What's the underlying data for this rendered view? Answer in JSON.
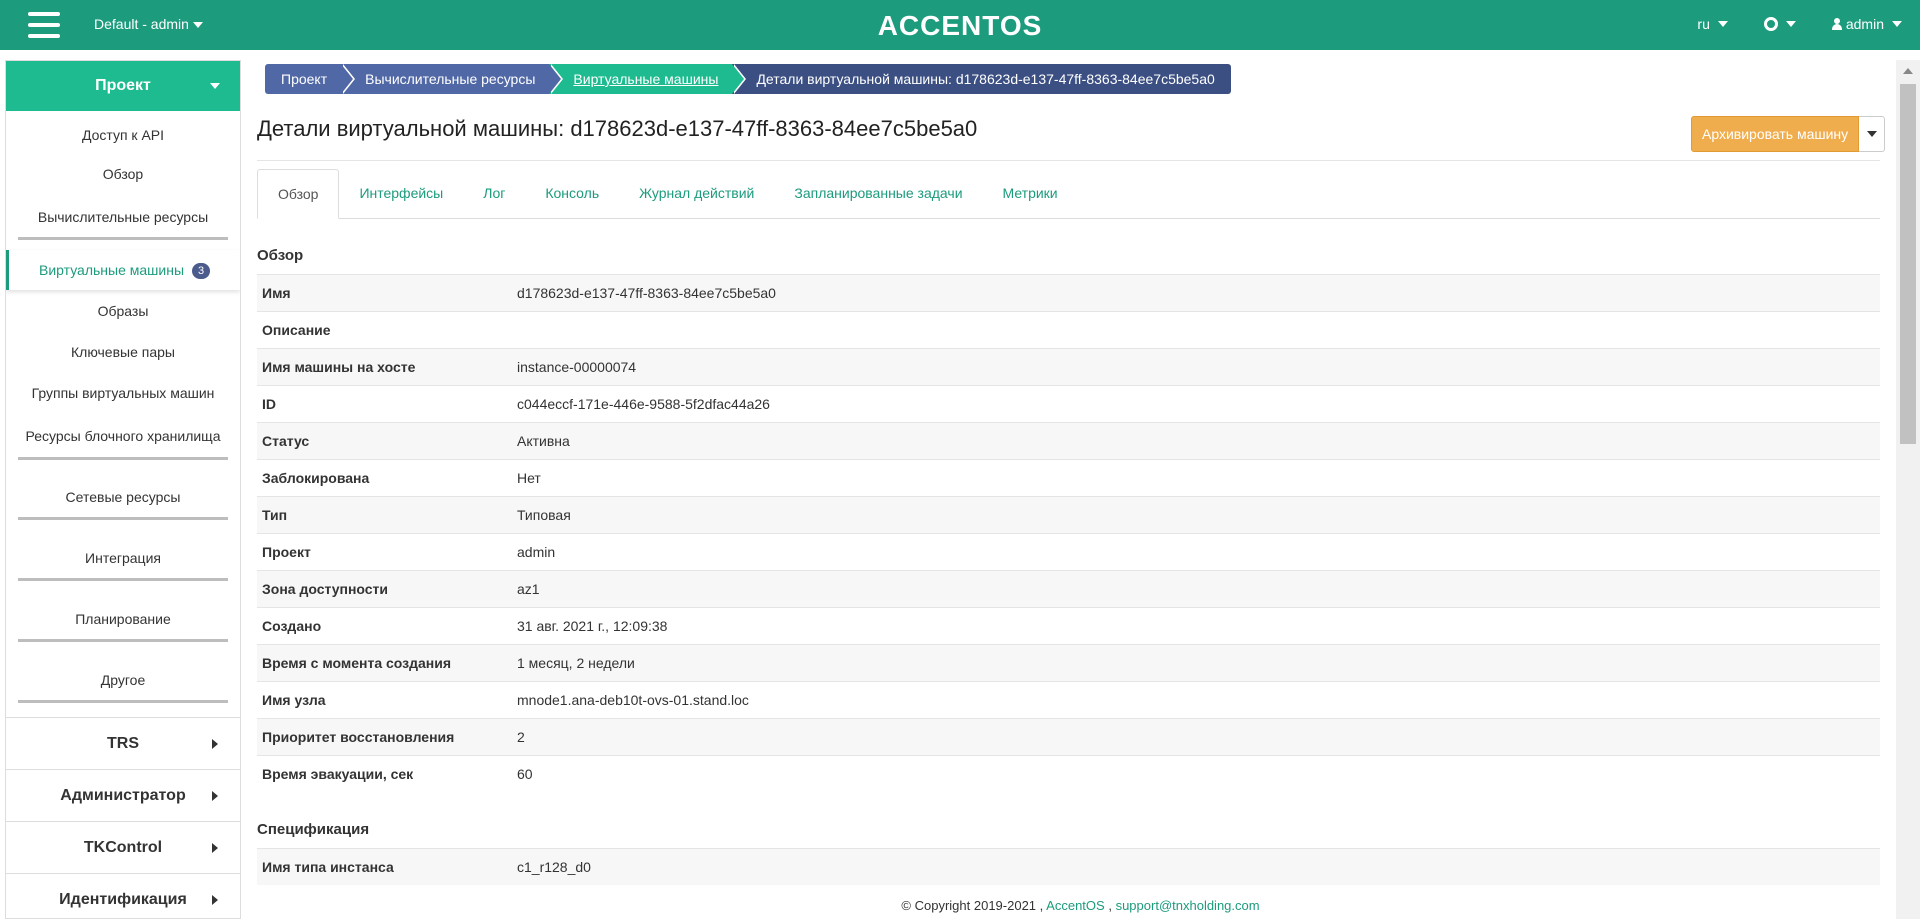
{
  "topbar": {
    "project": "Default - admin",
    "logo": "ACCENTOS",
    "lang": "ru",
    "user": "admin"
  },
  "sidebar": {
    "header": "Проект",
    "items": [
      {
        "label": "Доступ к API"
      },
      {
        "label": "Обзор"
      },
      {
        "label": "Вычислительные ресурсы"
      },
      {
        "label": "Виртуальные машины",
        "badge": "3"
      },
      {
        "label": "Образы"
      },
      {
        "label": "Ключевые пары"
      },
      {
        "label": "Группы виртуальных машин"
      },
      {
        "label": "Ресурсы блочного хранилища"
      },
      {
        "label": "Сетевые ресурсы"
      },
      {
        "label": "Интеграция"
      },
      {
        "label": "Планирование"
      },
      {
        "label": "Другое"
      }
    ],
    "sections": [
      "TRS",
      "Администратор",
      "TKControl",
      "Идентификация"
    ]
  },
  "breadcrumb": [
    "Проект",
    "Вычислительные ресурсы",
    "Виртуальные машины",
    "Детали виртуальной машины: d178623d-e137-47ff-8363-84ee7c5be5a0"
  ],
  "page": {
    "title": "Детали виртуальной машины: d178623d-e137-47ff-8363-84ee7c5be5a0",
    "archive_label": "Архивировать машину"
  },
  "tabs": [
    "Обзор",
    "Интерфейсы",
    "Лог",
    "Консоль",
    "Журнал действий",
    "Запланированные задачи",
    "Метрики"
  ],
  "overview": {
    "title": "Обзор",
    "rows": [
      {
        "k": "Имя",
        "v": "d178623d-e137-47ff-8363-84ee7c5be5a0"
      },
      {
        "k": "Описание",
        "v": ""
      },
      {
        "k": "Имя машины на хосте",
        "v": "instance-00000074"
      },
      {
        "k": "ID",
        "v": "c044eccf-171e-446e-9588-5f2dfac44a26"
      },
      {
        "k": "Статус",
        "v": "Активна"
      },
      {
        "k": "Заблокирована",
        "v": "Нет"
      },
      {
        "k": "Тип",
        "v": "Типовая"
      },
      {
        "k": "Проект",
        "v": "admin"
      },
      {
        "k": "Зона доступности",
        "v": "az1"
      },
      {
        "k": "Создано",
        "v": "31 авг. 2021 г., 12:09:38"
      },
      {
        "k": "Время с момента создания",
        "v": "1 месяц, 2 недели"
      },
      {
        "k": "Имя узла",
        "v": "mnode1.ana-deb10t-ovs-01.stand.loc"
      },
      {
        "k": "Приоритет восстановления",
        "v": "2"
      },
      {
        "k": "Время эвакуации, сек",
        "v": "60"
      }
    ]
  },
  "spec": {
    "title": "Спецификация",
    "rows": [
      {
        "k": "Имя типа инстанса",
        "v": "c1_r128_d0"
      }
    ]
  },
  "footer": {
    "copyright": "© Copyright 2019-2021 ,",
    "link1": "AccentOS",
    "sep": ",",
    "link2": "support@tnxholding.com"
  }
}
